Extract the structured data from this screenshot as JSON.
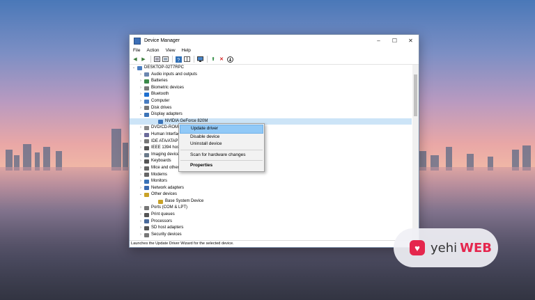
{
  "window": {
    "title": "Device Manager",
    "controls": {
      "minimize": "–",
      "maximize": "☐",
      "close": "✕"
    }
  },
  "menu": [
    "File",
    "Action",
    "View",
    "Help"
  ],
  "toolbar_icons": [
    "back-arrow-icon",
    "forward-arrow-icon",
    "properties-icon",
    "show-hidden-icon",
    "help-icon",
    "view-icon",
    "monitor-icon",
    "update-driver-icon",
    "uninstall-icon",
    "scan-icon"
  ],
  "tree": {
    "root": "DESKTOP-02T7RPC",
    "items": [
      {
        "label": "Audio inputs and outputs",
        "expanded": false,
        "indent": 1
      },
      {
        "label": "Batteries",
        "expanded": false,
        "indent": 1
      },
      {
        "label": "Biometric devices",
        "expanded": false,
        "indent": 1
      },
      {
        "label": "Bluetooth",
        "expanded": false,
        "indent": 1
      },
      {
        "label": "Computer",
        "expanded": false,
        "indent": 1
      },
      {
        "label": "Disk drives",
        "expanded": false,
        "indent": 1
      },
      {
        "label": "Display adapters",
        "expanded": true,
        "indent": 1
      },
      {
        "label": "NVIDIA GeForce 820M",
        "expanded": null,
        "indent": 2,
        "selected": true
      },
      {
        "label": "DVD/CD-ROM drives",
        "expanded": false,
        "indent": 1
      },
      {
        "label": "Human Interface Devices",
        "expanded": false,
        "indent": 1
      },
      {
        "label": "IDE ATA/ATAPI controllers",
        "expanded": false,
        "indent": 1
      },
      {
        "label": "IEEE 1394 host controllers",
        "expanded": false,
        "indent": 1
      },
      {
        "label": "Imaging devices",
        "expanded": false,
        "indent": 1
      },
      {
        "label": "Keyboards",
        "expanded": false,
        "indent": 1
      },
      {
        "label": "Mice and other pointing devices",
        "expanded": false,
        "indent": 1
      },
      {
        "label": "Modems",
        "expanded": false,
        "indent": 1
      },
      {
        "label": "Monitors",
        "expanded": false,
        "indent": 1
      },
      {
        "label": "Network adapters",
        "expanded": false,
        "indent": 1
      },
      {
        "label": "Other devices",
        "expanded": true,
        "indent": 1
      },
      {
        "label": "Base System Device",
        "expanded": null,
        "indent": 2
      },
      {
        "label": "Ports (COM & LPT)",
        "expanded": false,
        "indent": 1
      },
      {
        "label": "Print queues",
        "expanded": false,
        "indent": 1
      },
      {
        "label": "Processors",
        "expanded": false,
        "indent": 1
      },
      {
        "label": "SD host adapters",
        "expanded": false,
        "indent": 1
      },
      {
        "label": "Security devices",
        "expanded": false,
        "indent": 1
      }
    ]
  },
  "context_menu": {
    "update": "Update driver",
    "disable": "Disable device",
    "uninstall": "Uninstall device",
    "scan": "Scan for hardware changes",
    "properties": "Properties"
  },
  "status": "Launches the Update Driver Wizard for the selected device.",
  "watermark": {
    "text1": "yehi",
    "text2": "WEB",
    "color": "#e5264d"
  }
}
